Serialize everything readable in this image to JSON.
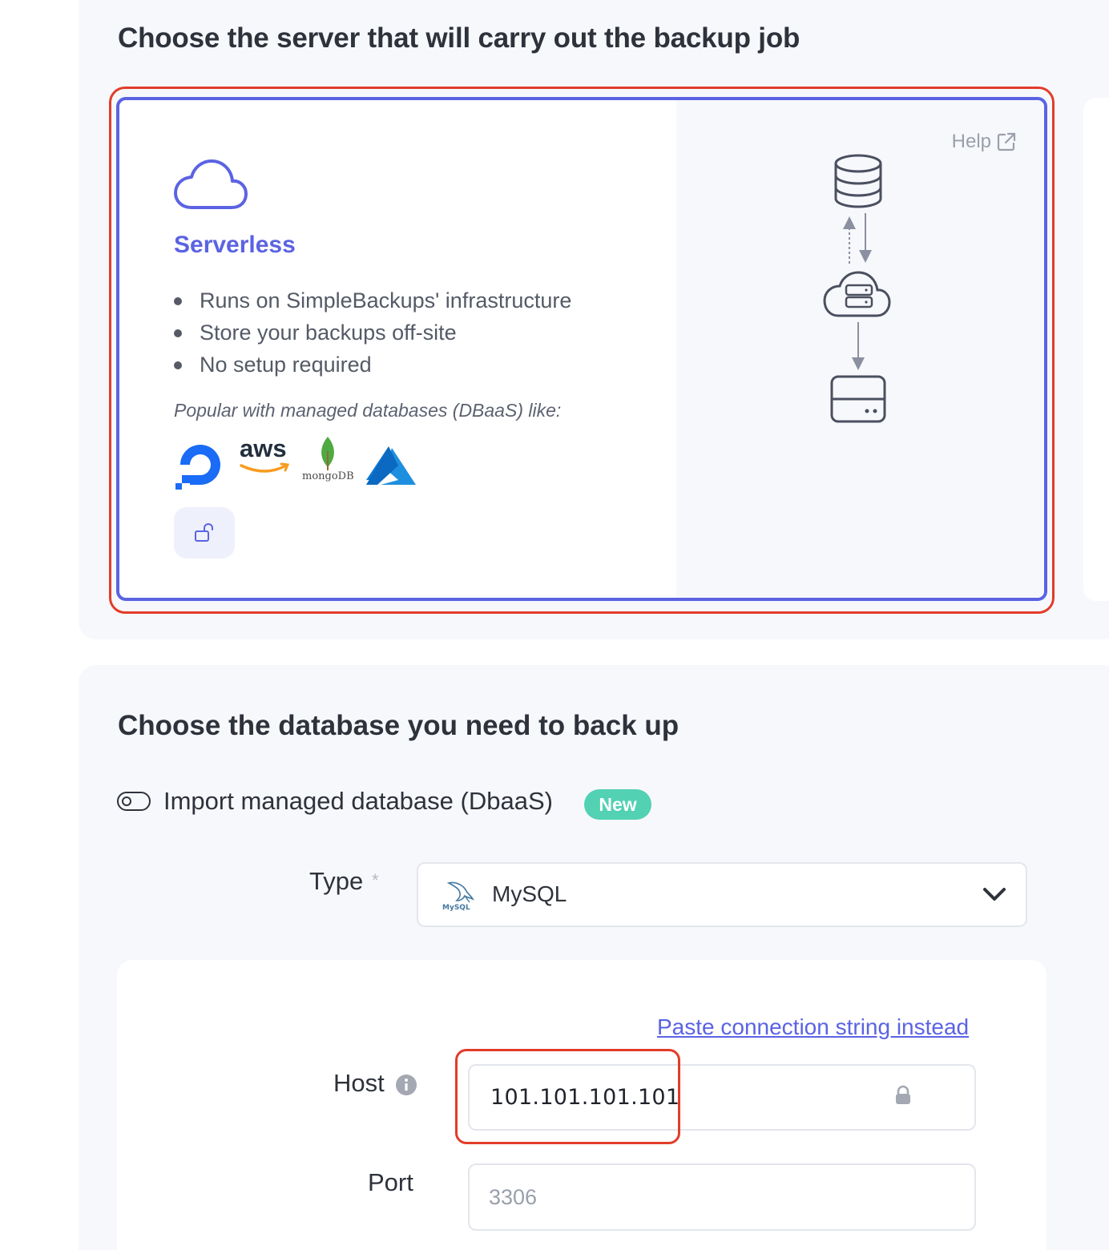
{
  "server_section": {
    "heading": "Choose the server that will carry out the backup job",
    "card": {
      "title": "Serverless",
      "bullets": [
        "Runs on SimpleBackups' infrastructure",
        "Store your backups off-site",
        "No setup required"
      ],
      "popular_text": "Popular with managed databases (DBaaS) like:",
      "logos": [
        "digitalocean-logo",
        "aws-logo",
        "mongodb-logo",
        "azure-logo"
      ],
      "logo_texts": {
        "aws": "aws",
        "mongodb": "mongoDB"
      },
      "help_label": "Help",
      "selected": true
    }
  },
  "database_section": {
    "heading": "Choose the database you need to back up",
    "import_toggle": {
      "label": "Import managed database (DbaaS)",
      "badge": "New",
      "on": false
    },
    "type": {
      "label": "Type",
      "required_mark": "*",
      "value": "MySQL",
      "logo_text": "MySQL"
    },
    "paste_link": "Paste connection string instead",
    "host": {
      "label": "Host",
      "value": "101.101.101.101"
    },
    "port": {
      "label": "Port",
      "placeholder": "3306"
    }
  },
  "colors": {
    "accent": "#5b63e3",
    "highlight": "#e23c2a",
    "badge": "#52d1b3",
    "panel": "#f7f8fb"
  }
}
